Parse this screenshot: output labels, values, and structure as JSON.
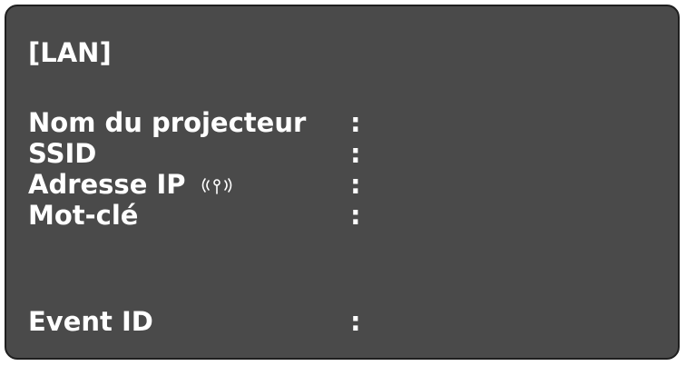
{
  "screen": {
    "title": "[LAN]",
    "rows": [
      {
        "label": "Nom du projecteur",
        "separator": ":"
      },
      {
        "label": "SSID",
        "separator": ":"
      },
      {
        "label": "Adresse IP",
        "separator": ":",
        "icon": "wireless-signal-icon"
      },
      {
        "label": "Mot-clé",
        "separator": ":"
      },
      {
        "label": "Event ID",
        "separator": ":"
      }
    ]
  },
  "colors": {
    "background": "#4a4a4a",
    "border": "#1f1f1f",
    "text": "#ffffff"
  }
}
